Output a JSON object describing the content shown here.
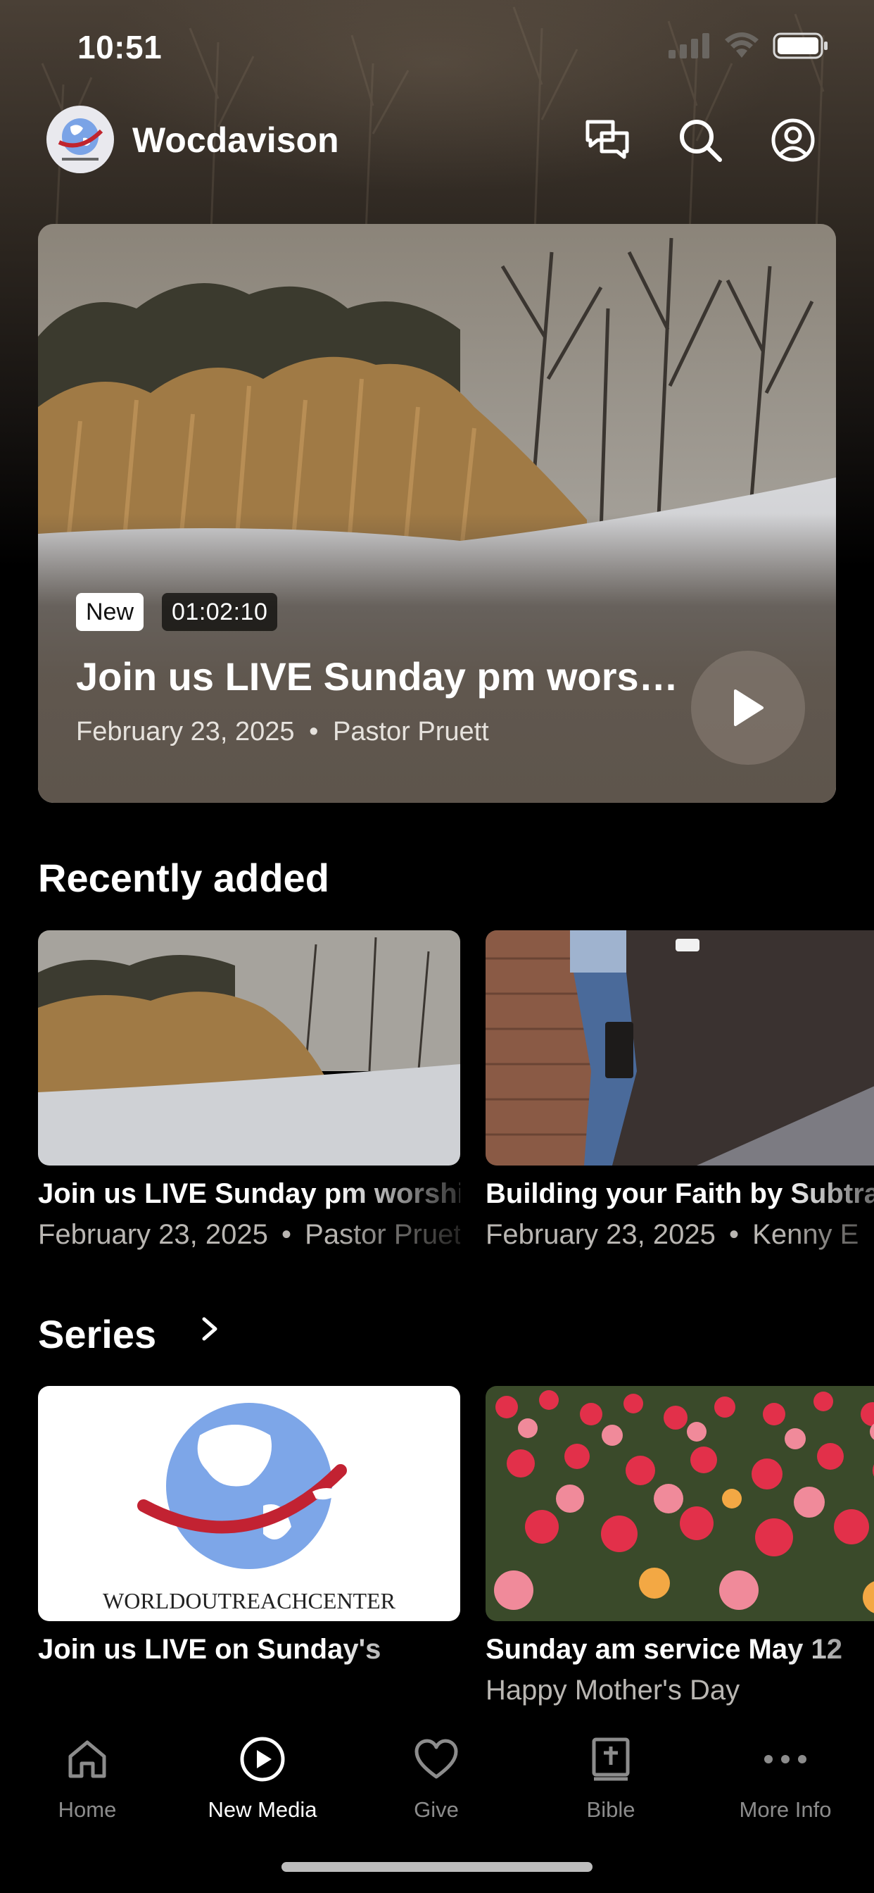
{
  "status_bar": {
    "time": "10:51"
  },
  "header": {
    "title": "Wocdavison",
    "icons": [
      "chat-icon",
      "search-icon",
      "profile-icon"
    ]
  },
  "hero": {
    "badge": "New",
    "duration": "01:02:10",
    "title": "Join us LIVE Sunday pm worship",
    "date": "February 23, 2025",
    "separator": "•",
    "author": "Pastor Pruett"
  },
  "recently_added": {
    "title": "Recently added",
    "items": [
      {
        "title": "Join us LIVE Sunday pm worship",
        "date": "February 23, 2025",
        "author": "Pastor Pruett"
      },
      {
        "title": "Building your Faith by Subtraction",
        "date": "February 23, 2025",
        "author": "Kenny E"
      }
    ]
  },
  "series": {
    "title": "Series",
    "items": [
      {
        "title": "Join us LIVE on Sunday's",
        "subtitle": "",
        "logo_text": "WORLDOUTREACHCENTER"
      },
      {
        "title": "Sunday am service May 12",
        "subtitle": "Happy Mother's Day"
      }
    ]
  },
  "tab_bar": {
    "tabs": [
      {
        "label": "Home",
        "icon": "home-icon",
        "active": false
      },
      {
        "label": "New Media",
        "icon": "play-circle-icon",
        "active": true
      },
      {
        "label": "Give",
        "icon": "heart-icon",
        "active": false
      },
      {
        "label": "Bible",
        "icon": "bible-icon",
        "active": false
      },
      {
        "label": "More Info",
        "icon": "more-icon",
        "active": false
      }
    ]
  },
  "colors": {
    "accent_active": "#ffffff",
    "inactive": "#8c8c8c",
    "hero_panel": "#5e554c"
  }
}
